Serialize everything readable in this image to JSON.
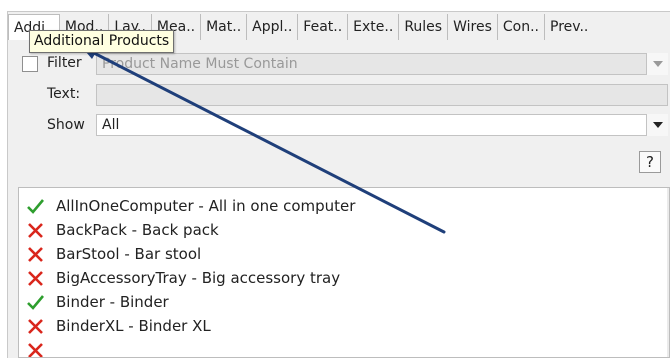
{
  "tabs": [
    {
      "label": "Addi..",
      "active": true
    },
    {
      "label": "Mod.."
    },
    {
      "label": "Lay.."
    },
    {
      "label": "Mea.."
    },
    {
      "label": "Mat.."
    },
    {
      "label": "Appl.."
    },
    {
      "label": "Feat.."
    },
    {
      "label": "Exte.."
    },
    {
      "label": "Rules"
    },
    {
      "label": "Wires"
    },
    {
      "label": "Con.."
    },
    {
      "label": "Prev.."
    }
  ],
  "tooltip": "Additional Products",
  "filter": {
    "label": "Filter",
    "placeholder": "Product Name Must Contain",
    "checked": false
  },
  "text_field": {
    "label": "Text:",
    "value": ""
  },
  "show": {
    "label": "Show",
    "value": "All"
  },
  "help": {
    "label": "?"
  },
  "products": [
    {
      "text": "AllInOneComputer - All in one computer",
      "status": "check"
    },
    {
      "text": "BackPack - Back pack",
      "status": "cross"
    },
    {
      "text": "BarStool - Bar stool",
      "status": "cross"
    },
    {
      "text": "BigAccessoryTray - Big accessory tray",
      "status": "cross"
    },
    {
      "text": "Binder - Binder",
      "status": "check"
    },
    {
      "text": "BinderXL - Binder XL",
      "status": "cross"
    },
    {
      "text": "",
      "status": "cross"
    }
  ],
  "colors": {
    "check": "#2e9e2e",
    "cross": "#d9261c",
    "arrow": "#1f3f7a",
    "tooltip_bg": "#ffffe1"
  },
  "icons": {
    "check": "check-icon",
    "cross": "cross-icon",
    "dropdown": "chevron-down-icon"
  }
}
